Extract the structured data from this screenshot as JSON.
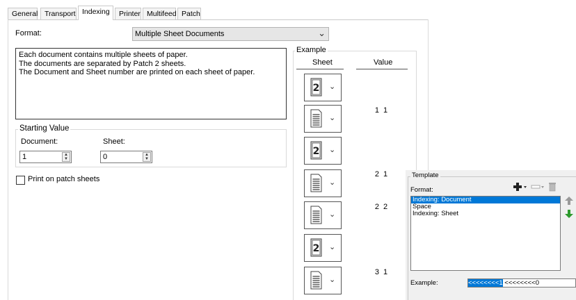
{
  "tabs": [
    {
      "label": "General"
    },
    {
      "label": "Transport"
    },
    {
      "label": "Indexing",
      "active": true
    },
    {
      "label": "Printer"
    },
    {
      "label": "Multifeed"
    },
    {
      "label": "Patch"
    }
  ],
  "format": {
    "label": "Format:",
    "value": "Multiple Sheet Documents"
  },
  "description": [
    "Each document contains multiple sheets of paper.",
    "The documents are separated by Patch 2 sheets.",
    "The Document and Sheet number are printed on each sheet of paper."
  ],
  "starting_value": {
    "title": "Starting Value",
    "document_label": "Document:",
    "document_value": "1",
    "sheet_label": "Sheet:",
    "sheet_value": "0"
  },
  "print_on_patch": {
    "label": "Print on patch sheets",
    "checked": false
  },
  "example": {
    "title": "Example",
    "sheet_header": "Sheet",
    "value_header": "Value",
    "rows": [
      {
        "icon": "patch-2-sheet-icon",
        "value": ""
      },
      {
        "icon": "document-page-icon",
        "value": "1  1"
      },
      {
        "icon": "patch-2-sheet-icon",
        "value": ""
      },
      {
        "icon": "document-page-icon",
        "value": "2  1"
      },
      {
        "icon": "document-page-icon",
        "value": "2  2"
      },
      {
        "icon": "patch-2-sheet-icon",
        "value": ""
      },
      {
        "icon": "document-page-icon",
        "value": "3  1"
      }
    ]
  },
  "template": {
    "title": "Template",
    "format_label": "Format:",
    "items": [
      {
        "label": "Indexing: Document",
        "selected": true
      },
      {
        "label": "Space",
        "selected": false
      },
      {
        "label": "Indexing: Sheet",
        "selected": false
      }
    ],
    "example_label": "Example:",
    "example_selected": "<<<<<<<<1",
    "example_rest": " <<<<<<<<0"
  },
  "colors": {
    "selection": "#0078d7",
    "up_arrow": "#9a9a9a",
    "down_arrow": "#2e9a2e"
  }
}
